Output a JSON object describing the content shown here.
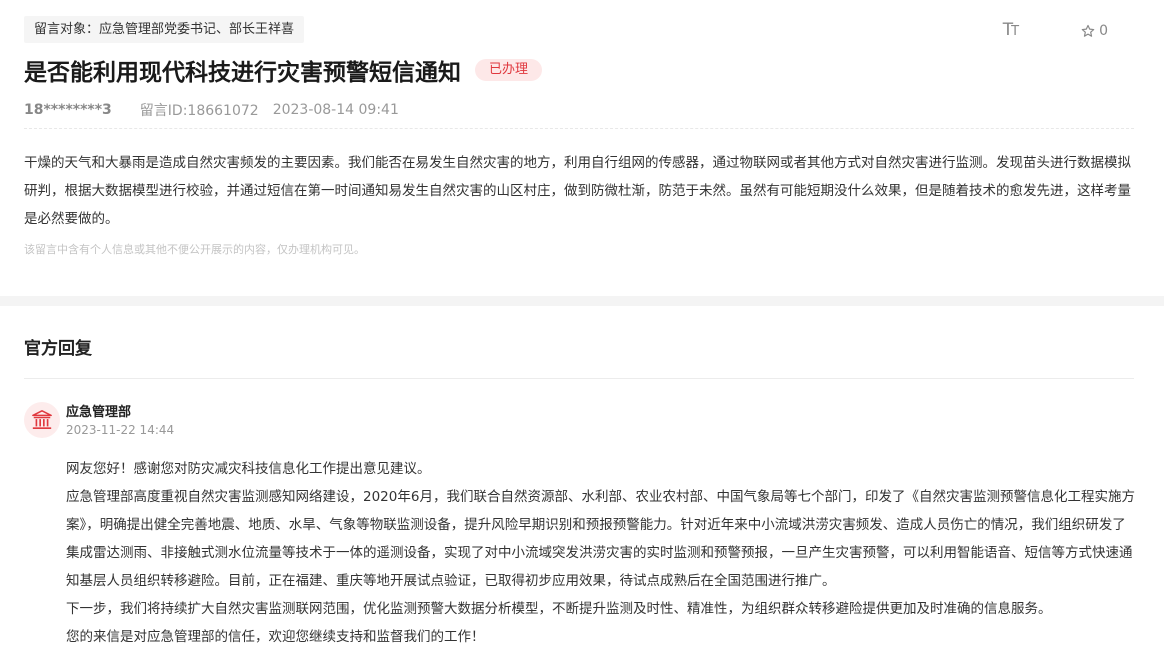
{
  "message": {
    "target_label": "留言对象：",
    "target_value": "应急管理部党委书记、部长王祥喜",
    "font_size_icon": "text-size-icon",
    "favorite_icon": "star-outline-icon",
    "favorite_count": "0",
    "title": "是否能利用现代科技进行灾害预警短信通知",
    "status": "已办理",
    "author": "18********3",
    "message_id": "留言ID:18661072",
    "date": "2023-08-14 09:41",
    "content": "干燥的天气和大暴雨是造成自然灾害频发的主要因素。我们能否在易发生自然灾害的地方，利用自行组网的传感器，通过物联网或者其他方式对自然灾害进行监测。发现苗头进行数据模拟研判，根据大数据模型进行校验，并通过短信在第一时间通知易发生自然灾害的山区村庄，做到防微杜渐，防范于未然。虽然有可能短期没什么效果，但是随着技术的愈发先进，这样考量是必然要做的。",
    "privacy_notice": "该留言中含有个人信息或其他不便公开展示的内容，仅办理机构可见。"
  },
  "reply": {
    "heading": "官方回复",
    "avatar_icon": "government-building-icon",
    "department": "应急管理部",
    "time": "2023-11-22 14:44",
    "paragraphs": [
      "网友您好！感谢您对防灾减灾科技信息化工作提出意见建议。",
      "应急管理部高度重视自然灾害监测感知网络建设，2020年6月，我们联合自然资源部、水利部、农业农村部、中国气象局等七个部门，印发了《自然灾害监测预警信息化工程实施方案》，明确提出健全完善地震、地质、水旱、气象等物联监测设备，提升风险早期识别和预报预警能力。针对近年来中小流域洪涝灾害频发、造成人员伤亡的情况，我们组织研发了集成雷达测雨、非接触式测水位流量等技术于一体的遥测设备，实现了对中小流域突发洪涝灾害的实时监测和预警预报，一旦产生灾害预警，可以利用智能语音、短信等方式快速通知基层人员组织转移避险。目前，正在福建、重庆等地开展试点验证，已取得初步应用效果，待试点成熟后在全国范围进行推广。",
      "下一步，我们将持续扩大自然灾害监测联网范围，优化监测预警大数据分析模型，不断提升监测及时性、精准性，为组织群众转移避险提供更加及时准确的信息服务。",
      "您的来信是对应急管理部的信任，欢迎您继续支持和监督我们的工作！"
    ]
  },
  "colors": {
    "status_text": "#e0383e",
    "status_bg": "#fde8e8",
    "avatar_bg": "#fdecec",
    "avatar_icon": "#e0383e"
  }
}
